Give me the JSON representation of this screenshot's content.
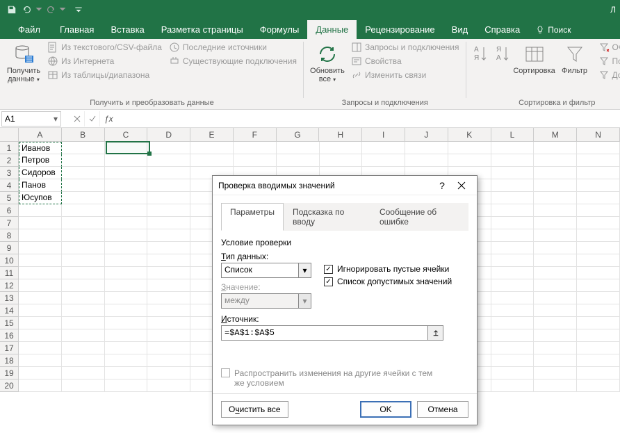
{
  "titlebar": {
    "doc_title_right": "Л"
  },
  "ribbon_tabs": {
    "file": "Файл",
    "home": "Главная",
    "insert": "Вставка",
    "layout": "Разметка страницы",
    "formulas": "Формулы",
    "data": "Данные",
    "review": "Рецензирование",
    "view": "Вид",
    "help": "Справка",
    "search": "Поиск"
  },
  "ribbon": {
    "get_data_btn": "Получить данные",
    "from_csv": "Из текстового/CSV-файла",
    "from_web": "Из Интернета",
    "from_table": "Из таблицы/диапазона",
    "recent_sources": "Последние источники",
    "existing_conn": "Существующие подключения",
    "group1_label": "Получить и преобразовать данные",
    "refresh_all": "Обновить все",
    "queries": "Запросы и подключения",
    "properties": "Свойства",
    "edit_links": "Изменить связи",
    "group2_label": "Запросы и подключения",
    "sort": "Сортировка",
    "filter": "Фильтр",
    "clear": "Очисти",
    "reapply": "Повтор",
    "advanced": "Дополн",
    "group3_label": "Сортировка и фильтр"
  },
  "name_box": "A1",
  "columns": [
    "A",
    "B",
    "C",
    "D",
    "E",
    "F",
    "G",
    "H",
    "I",
    "J",
    "K",
    "L",
    "M",
    "N"
  ],
  "rows": [
    "1",
    "2",
    "3",
    "4",
    "5",
    "6",
    "7",
    "8",
    "9",
    "10",
    "11",
    "12",
    "13",
    "14",
    "15",
    "16",
    "17",
    "18",
    "19",
    "20"
  ],
  "cells": {
    "A1": "Иванов",
    "A2": "Петров",
    "A3": "Сидоров",
    "A4": "Панов",
    "A5": "Юсупов"
  },
  "selected_cell": "C1",
  "copy_range": "A1:A5",
  "dialog": {
    "title": "Проверка вводимых значений",
    "tab_params": "Параметры",
    "tab_hint": "Подсказка по вводу",
    "tab_error": "Сообщение об ошибке",
    "section": "Условие проверки",
    "type_label": "Тип данных:",
    "type_value": "Список",
    "value_label": "Значение:",
    "value_value": "между",
    "source_label": "Источник:",
    "source_value": "=$A$1:$A$5",
    "ignore_empty": "Игнорировать пустые ячейки",
    "list_dropdown": "Список допустимых значений",
    "spread": "Распространить изменения на другие ячейки с тем же условием",
    "clear_all": "Очистить все",
    "ok": "OK",
    "cancel": "Отмена"
  }
}
